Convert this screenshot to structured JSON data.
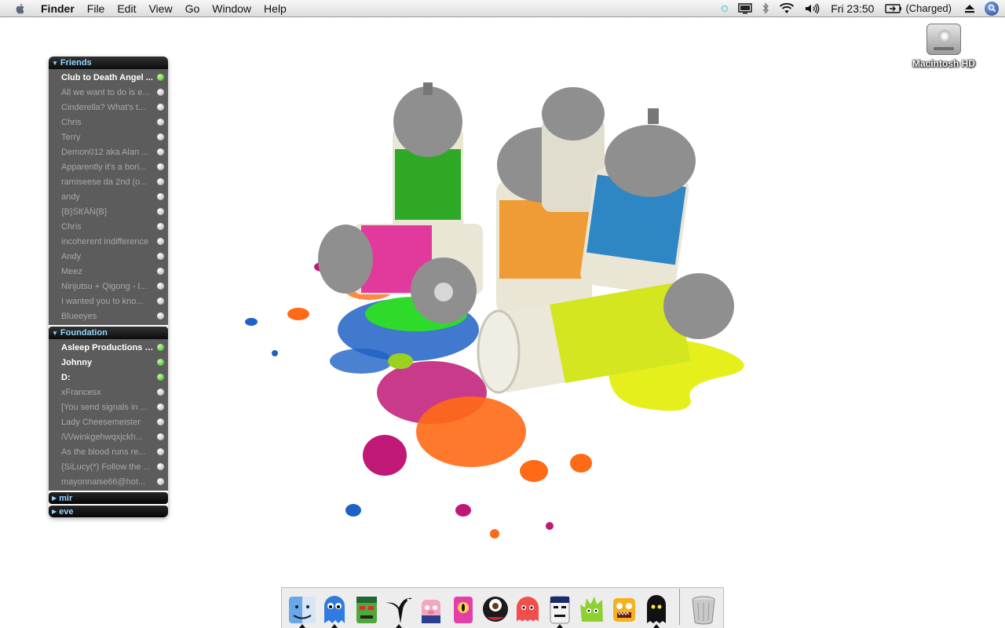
{
  "menubar": {
    "app_name": "Finder",
    "menus": [
      "File",
      "Edit",
      "View",
      "Go",
      "Window",
      "Help"
    ],
    "clock": "Fri 23:50",
    "battery_status": "(Charged)"
  },
  "desktop": {
    "drive_label": "Macintosh HD"
  },
  "buddy_list": {
    "groups": [
      {
        "name": "Friends",
        "contacts": [
          {
            "name": "Club to Death Angel ...",
            "online": true
          },
          {
            "name": "All we want to do is e...",
            "online": false
          },
          {
            "name": "Cinderella? What's t...",
            "online": false
          },
          {
            "name": "Chris",
            "online": false
          },
          {
            "name": "Terry",
            "online": false
          },
          {
            "name": "Demon012 aka Alan ...",
            "online": false
          },
          {
            "name": "Apparently it's a bori...",
            "online": false
          },
          {
            "name": "ramiseese da 2nd (o...",
            "online": false
          },
          {
            "name": "andy",
            "online": false
          },
          {
            "name": "{B}ŠłťĂŇ{B}",
            "online": false
          },
          {
            "name": "Chris",
            "online": false
          },
          {
            "name": "incoherent indifference",
            "online": false
          },
          {
            "name": "Andy",
            "online": false
          },
          {
            "name": "Meez",
            "online": false
          },
          {
            "name": "Ninjutsu + Qigong - l...",
            "online": false
          },
          {
            "name": "I wanted you to kno...",
            "online": false
          },
          {
            "name": "Blueeyes",
            "online": false
          }
        ]
      },
      {
        "name": "Foundation",
        "contacts": [
          {
            "name": "Asleep Productions -...",
            "online": true
          },
          {
            "name": "Johnny",
            "online": true
          },
          {
            "name": "D:",
            "online": true
          },
          {
            "name": "xFrancesx",
            "online": false
          },
          {
            "name": "[You send signals in ...",
            "online": false
          },
          {
            "name": "Lady Cheesemeister",
            "online": false
          },
          {
            "name": "/\\/\\/winkgehwqxjckh...",
            "online": false
          },
          {
            "name": "As the blood runs re...",
            "online": false
          },
          {
            "name": "{SiLucy(*) Follow the ...",
            "online": false
          },
          {
            "name": "mayonnaise66@hot...",
            "online": false
          }
        ]
      }
    ],
    "collapsed_groups": [
      "mir",
      "eve"
    ]
  },
  "dock": {
    "items": [
      {
        "icon": "finder-icon",
        "running": true
      },
      {
        "icon": "blue-monster-icon",
        "running": true
      },
      {
        "icon": "green-frankenstein-icon",
        "running": false
      },
      {
        "icon": "black-bird-icon",
        "running": true
      },
      {
        "icon": "pink-pig-monster-icon",
        "running": false
      },
      {
        "icon": "pink-cyclops-icon",
        "running": false
      },
      {
        "icon": "black-eyeball-monster-icon",
        "running": false
      },
      {
        "icon": "red-octopus-icon",
        "running": false
      },
      {
        "icon": "white-face-monster-icon",
        "running": true
      },
      {
        "icon": "green-fuzzy-monster-icon",
        "running": false
      },
      {
        "icon": "yellow-monster-icon",
        "running": false
      },
      {
        "icon": "black-ghost-icon",
        "running": true
      }
    ],
    "trash_icon": "trash-icon"
  }
}
